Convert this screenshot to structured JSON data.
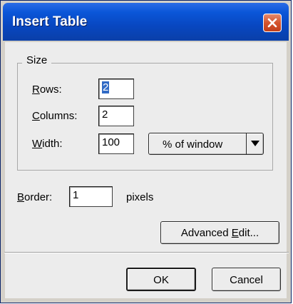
{
  "dialog": {
    "title": "Insert Table"
  },
  "size_group": {
    "legend": "Size",
    "rows": {
      "label_mnemonic": "R",
      "label_rest": "ows:",
      "value": "2"
    },
    "columns": {
      "label_mnemonic": "C",
      "label_rest": "olumns:",
      "value": "2"
    },
    "width": {
      "label_mnemonic": "W",
      "label_rest": "idth:",
      "value": "100",
      "unit_selected": "% of window"
    }
  },
  "border": {
    "label_mnemonic": "B",
    "label_rest": "order:",
    "value": "1",
    "unit": "pixels"
  },
  "advanced_button": {
    "label_before": "Advanced ",
    "label_mnemonic": "E",
    "label_after": "dit..."
  },
  "ok_button": {
    "label": "OK"
  },
  "cancel_button": {
    "label": "Cancel"
  },
  "icons": {
    "close": "close-icon",
    "dropdown": "triangle-down-icon"
  },
  "colors": {
    "titlebar": "#0a56d8",
    "close_button": "#d5542d",
    "dialog_background": "#ececec",
    "selection": "#316ac5"
  }
}
